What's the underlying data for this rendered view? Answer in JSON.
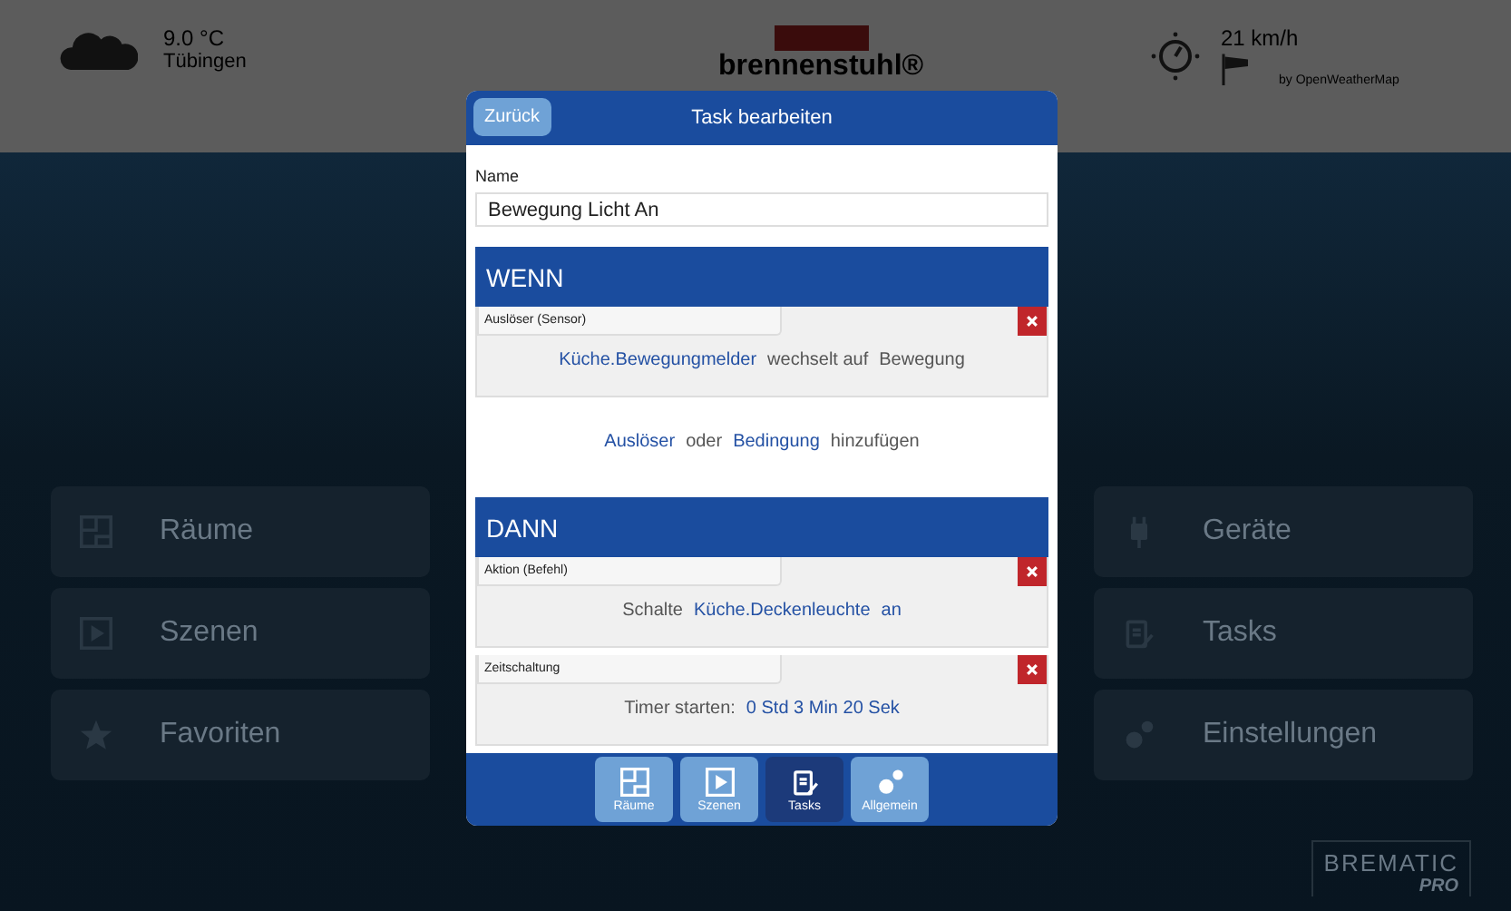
{
  "weather": {
    "temperature": "9.0 °C",
    "city": "Tübingen"
  },
  "brand": {
    "name": "brennenstuhl®"
  },
  "wind": {
    "speed": "21 km/h",
    "source": "by OpenWeatherMap"
  },
  "menu_left": [
    {
      "label": "Räume"
    },
    {
      "label": "Szenen"
    },
    {
      "label": "Favoriten"
    }
  ],
  "menu_right": [
    {
      "label": "Geräte"
    },
    {
      "label": "Tasks"
    },
    {
      "label": "Einstellungen"
    }
  ],
  "logo": {
    "name": "BREMATIC",
    "sub": "PRO"
  },
  "dialog": {
    "back": "Zurück",
    "title": "Task bearbeiten",
    "name_label": "Name",
    "name_value": "Bewegung Licht An",
    "sections": [
      {
        "title": "WENN",
        "cards": [
          {
            "label": "Auslöser (Sensor)",
            "parts": [
              {
                "kind": "link",
                "text": "Küche.Bewegungmelder"
              },
              {
                "kind": "text",
                "text": "wechselt auf"
              },
              {
                "kind": "text",
                "text": "Bewegung"
              }
            ]
          }
        ],
        "add": [
          {
            "kind": "link",
            "text": "Auslöser"
          },
          {
            "kind": "text",
            "text": "oder"
          },
          {
            "kind": "link",
            "text": "Bedingung"
          },
          {
            "kind": "text",
            "text": "hinzufügen"
          }
        ]
      },
      {
        "title": "DANN",
        "cards": [
          {
            "label": "Aktion (Befehl)",
            "parts": [
              {
                "kind": "text",
                "text": "Schalte"
              },
              {
                "kind": "link",
                "text": "Küche.Deckenleuchte"
              },
              {
                "kind": "link",
                "text": "an"
              }
            ]
          },
          {
            "label": "Zeitschaltung",
            "parts": [
              {
                "kind": "text",
                "text": "Timer starten:"
              },
              {
                "kind": "link",
                "text": "0 Std 3 Min 20 Sek"
              }
            ]
          }
        ]
      }
    ],
    "nav": [
      {
        "label": "Räume",
        "selected": false
      },
      {
        "label": "Szenen",
        "selected": false
      },
      {
        "label": "Tasks",
        "selected": true
      },
      {
        "label": "Allgemein",
        "selected": false
      }
    ]
  }
}
